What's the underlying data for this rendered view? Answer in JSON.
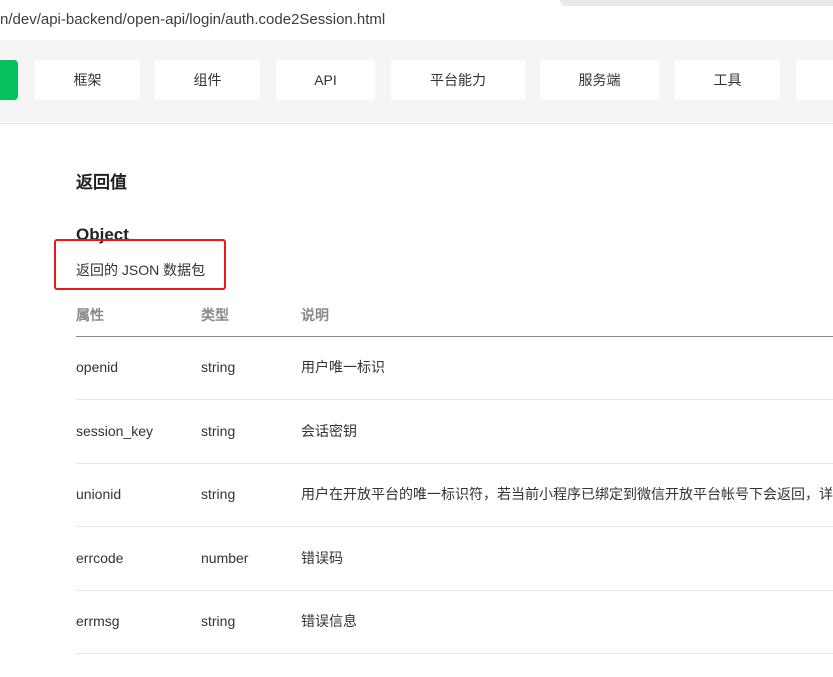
{
  "browser": {
    "url": "n/dev/api-backend/open-api/login/auth.code2Session.html"
  },
  "nav": {
    "items": [
      "框架",
      "组件",
      "API",
      "平台能力",
      "服务端",
      "工具"
    ]
  },
  "content": {
    "section_title": "返回值",
    "object_title": "Object",
    "object_desc": "返回的 JSON 数据包",
    "table": {
      "headers": [
        "属性",
        "类型",
        "说明"
      ],
      "rows": [
        {
          "name": "openid",
          "type": "string",
          "desc": "用户唯一标识"
        },
        {
          "name": "session_key",
          "type": "string",
          "desc": "会话密钥"
        },
        {
          "name": "unionid",
          "type": "string",
          "desc": "用户在开放平台的唯一标识符，若当前小程序已绑定到微信开放平台帐号下会返回，详"
        },
        {
          "name": "errcode",
          "type": "number",
          "desc": "错误码"
        },
        {
          "name": "errmsg",
          "type": "string",
          "desc": "错误信息"
        }
      ]
    }
  },
  "colors": {
    "accent_green": "#07c160",
    "highlight_red": "#e8191a"
  }
}
